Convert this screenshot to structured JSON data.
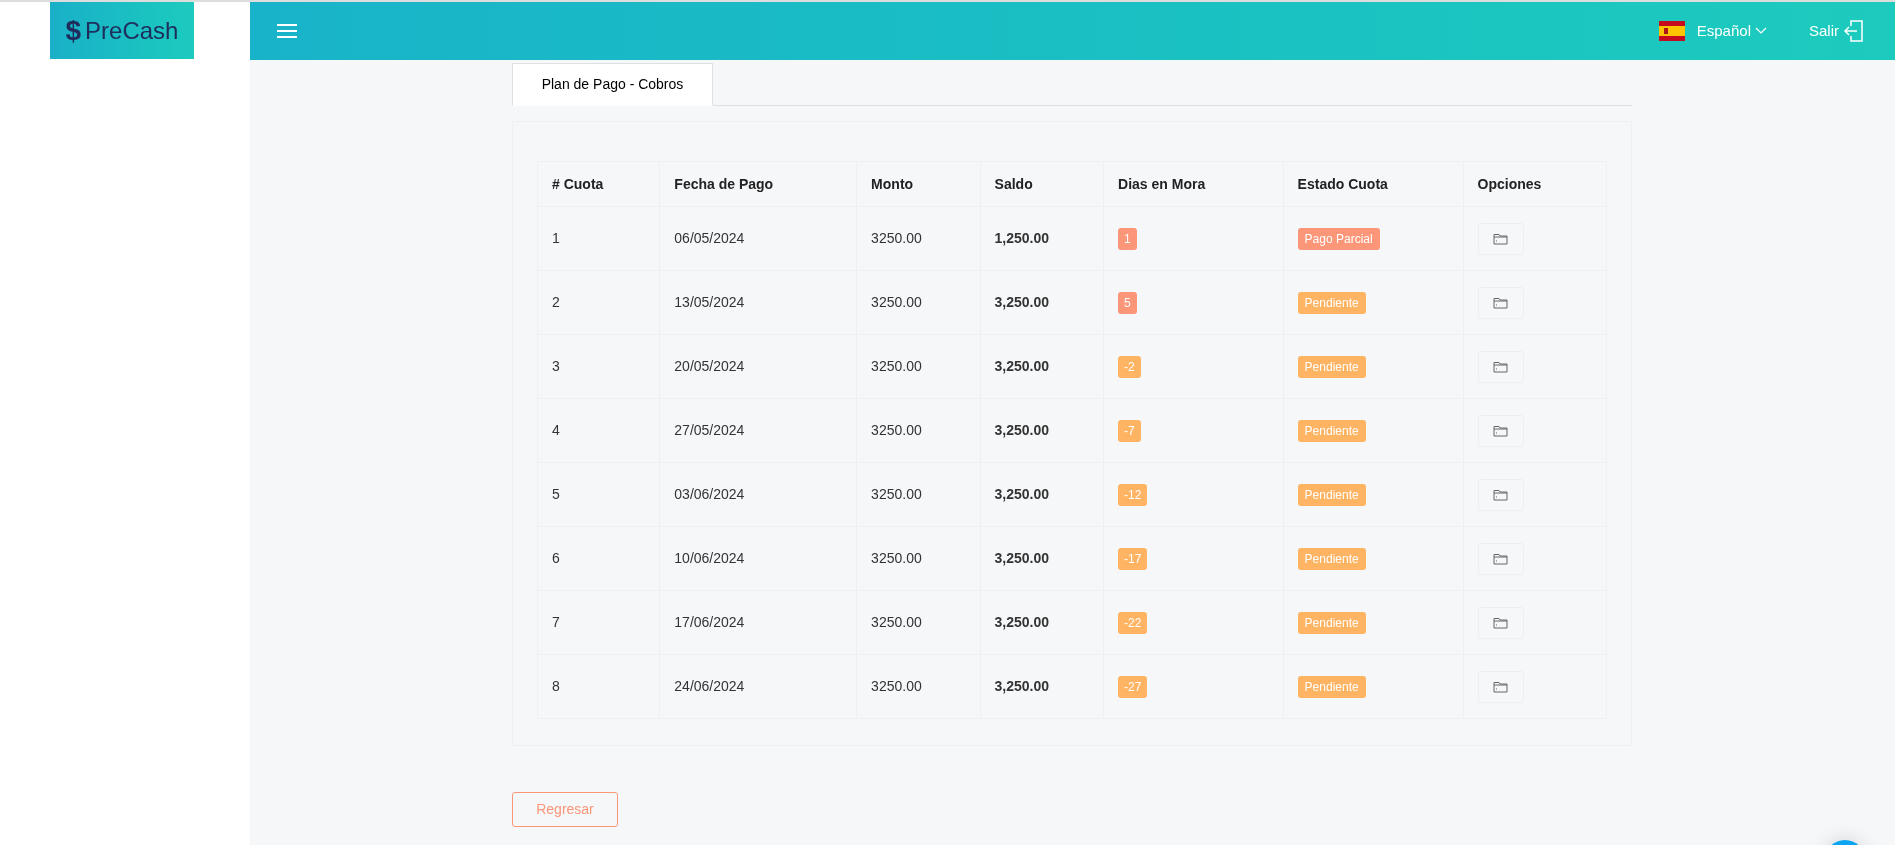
{
  "logo": {
    "symbol": "$",
    "text": "PreCash"
  },
  "header": {
    "language": "Español",
    "logout": "Salir"
  },
  "tabs": [
    {
      "label": "Plan de Pago - Cobros",
      "selected": true
    }
  ],
  "table": {
    "columns": [
      "# Cuota",
      "Fecha de Pago",
      "Monto",
      "Saldo",
      "Dias en Mora",
      "Estado Cuota",
      "Opciones"
    ],
    "rows": [
      {
        "cuota": "1",
        "fecha": "06/05/2024",
        "monto": "3250.00",
        "saldo": "1,250.00",
        "dias_mora": {
          "text": "1",
          "color": "#fb9678"
        },
        "estado": {
          "text": "Pago Parcial",
          "color": "#fb9678"
        }
      },
      {
        "cuota": "2",
        "fecha": "13/05/2024",
        "monto": "3250.00",
        "saldo": "3,250.00",
        "dias_mora": {
          "text": "5",
          "color": "#fb9678"
        },
        "estado": {
          "text": "Pendiente",
          "color": "#ffb463"
        }
      },
      {
        "cuota": "3",
        "fecha": "20/05/2024",
        "monto": "3250.00",
        "saldo": "3,250.00",
        "dias_mora": {
          "text": "-2",
          "color": "#ffb463"
        },
        "estado": {
          "text": "Pendiente",
          "color": "#ffb463"
        }
      },
      {
        "cuota": "4",
        "fecha": "27/05/2024",
        "monto": "3250.00",
        "saldo": "3,250.00",
        "dias_mora": {
          "text": "-7",
          "color": "#ffb463"
        },
        "estado": {
          "text": "Pendiente",
          "color": "#ffb463"
        }
      },
      {
        "cuota": "5",
        "fecha": "03/06/2024",
        "monto": "3250.00",
        "saldo": "3,250.00",
        "dias_mora": {
          "text": "-12",
          "color": "#ffb463"
        },
        "estado": {
          "text": "Pendiente",
          "color": "#ffb463"
        }
      },
      {
        "cuota": "6",
        "fecha": "10/06/2024",
        "monto": "3250.00",
        "saldo": "3,250.00",
        "dias_mora": {
          "text": "-17",
          "color": "#ffb463"
        },
        "estado": {
          "text": "Pendiente",
          "color": "#ffb463"
        }
      },
      {
        "cuota": "7",
        "fecha": "17/06/2024",
        "monto": "3250.00",
        "saldo": "3,250.00",
        "dias_mora": {
          "text": "-22",
          "color": "#ffb463"
        },
        "estado": {
          "text": "Pendiente",
          "color": "#ffb463"
        }
      },
      {
        "cuota": "8",
        "fecha": "24/06/2024",
        "monto": "3250.00",
        "saldo": "3,250.00",
        "dias_mora": {
          "text": "-27",
          "color": "#ffb463"
        },
        "estado": {
          "text": "Pendiente",
          "color": "#ffb463"
        }
      }
    ]
  },
  "back_button": "Regresar"
}
